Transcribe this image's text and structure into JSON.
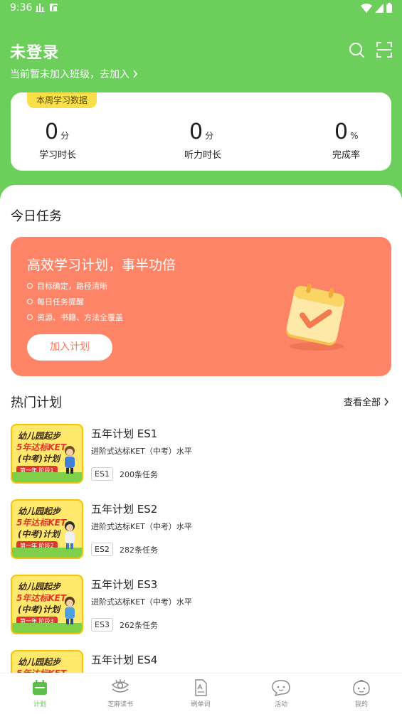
{
  "status_bar": {
    "time": "9:36"
  },
  "header": {
    "login_title": "未登录",
    "class_prompt": "当前暂未加入班级，去加入"
  },
  "stats": {
    "tag": "本周学习数据",
    "items": [
      {
        "value": "0",
        "unit": "分",
        "label": "学习时长"
      },
      {
        "value": "0",
        "unit": "分",
        "label": "听力时长"
      },
      {
        "value": "0",
        "unit": "%",
        "label": "完成率"
      }
    ]
  },
  "today": {
    "title": "今日任务",
    "promo": {
      "title": "高效学习计划，事半功倍",
      "bullets": [
        "目标确定，路径清晰",
        "每日任务提醒",
        "资源、书籍、方法全覆盖"
      ],
      "button": "加入计划"
    }
  },
  "hot": {
    "title": "热门计划",
    "view_all": "查看全部",
    "thumb": {
      "line1": "幼儿园起步",
      "line2": "5年达标KET",
      "line3": "(中考)计划"
    },
    "plans": [
      {
        "name": "五年计划 ES1",
        "desc": "进阶式达标KET（中考）水平",
        "tag": "ES1",
        "count": "200条任务",
        "stage": "第一年 阶段1"
      },
      {
        "name": "五年计划 ES2",
        "desc": "进阶式达标KET（中考）水平",
        "tag": "ES2",
        "count": "282条任务",
        "stage": "第一年 阶段2"
      },
      {
        "name": "五年计划 ES3",
        "desc": "进阶式达标KET（中考）水平",
        "tag": "ES3",
        "count": "262条任务",
        "stage": "第一年 阶段3"
      },
      {
        "name": "五年计划 ES4",
        "desc": "",
        "tag": "",
        "count": "",
        "stage": ""
      }
    ]
  },
  "nav": [
    {
      "label": "计划",
      "icon": "calendar-icon",
      "active": true
    },
    {
      "label": "芝麻读书",
      "icon": "reading-icon",
      "active": false
    },
    {
      "label": "刷单词",
      "icon": "document-icon",
      "active": false
    },
    {
      "label": "活动",
      "icon": "chat-face-icon",
      "active": false
    },
    {
      "label": "我的",
      "icon": "profile-face-icon",
      "active": false
    }
  ],
  "colors": {
    "brand_green": "#6ccf5b",
    "promo_orange": "#fd8466",
    "tag_yellow": "#f9e04a"
  }
}
